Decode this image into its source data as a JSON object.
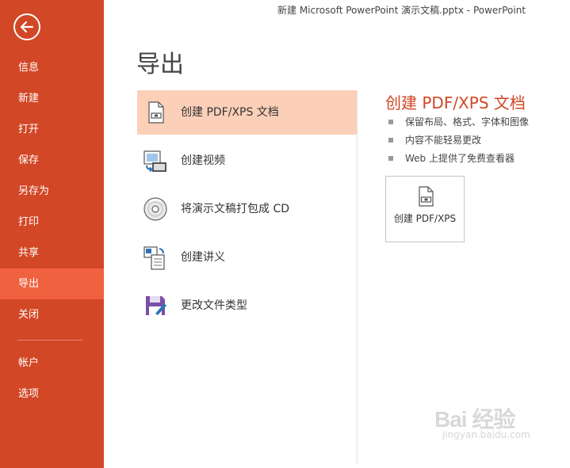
{
  "window": {
    "title": "新建 Microsoft PowerPoint 演示文稿.pptx - PowerPoint"
  },
  "sidebar": {
    "items": [
      {
        "label": "信息"
      },
      {
        "label": "新建"
      },
      {
        "label": "打开"
      },
      {
        "label": "保存"
      },
      {
        "label": "另存为"
      },
      {
        "label": "打印"
      },
      {
        "label": "共享"
      },
      {
        "label": "导出",
        "active": true
      },
      {
        "label": "关闭"
      }
    ],
    "bottom_items": [
      {
        "label": "帐户"
      },
      {
        "label": "选项"
      }
    ]
  },
  "page": {
    "heading": "导出"
  },
  "export_options": [
    {
      "label": "创建 PDF/XPS 文档",
      "icon": "pdf-document-icon",
      "selected": true
    },
    {
      "label": "创建视频",
      "icon": "video-icon"
    },
    {
      "label": "将演示文稿打包成 CD",
      "icon": "cd-icon"
    },
    {
      "label": "创建讲义",
      "icon": "handout-icon"
    },
    {
      "label": "更改文件类型",
      "icon": "file-type-icon"
    }
  ],
  "detail": {
    "title": "创建 PDF/XPS 文档",
    "bullets": [
      "保留布局、格式、字体和图像",
      "内容不能轻易更改",
      "Web 上提供了免费查看器"
    ],
    "button_label": "创建 PDF/XPS"
  },
  "watermark": {
    "text": "Bai 经验",
    "sub": "jingyan.baidu.com"
  },
  "colors": {
    "accent": "#d24726",
    "active_nav": "#f0623f",
    "selected_option": "#fbcfb8"
  }
}
